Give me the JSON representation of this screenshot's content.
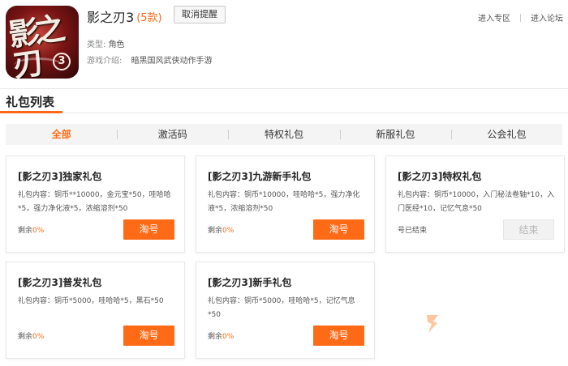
{
  "header": {
    "icon_text": "影之刃",
    "icon_number": "3",
    "title": "影之刃3",
    "count": "(5款)",
    "cancel_button": "取消提醒",
    "type_label": "类型:",
    "type_value": "角色",
    "intro_label": "游戏介绍:",
    "intro_value": "暗黑国风武侠动作手游",
    "links": [
      "进入专区",
      "进入论坛"
    ]
  },
  "section": {
    "title": "礼包列表"
  },
  "tabs": [
    {
      "label": "全部",
      "active": true
    },
    {
      "label": "激活码",
      "active": false
    },
    {
      "label": "特权礼包",
      "active": false
    },
    {
      "label": "新服礼包",
      "active": false
    },
    {
      "label": "公会礼包",
      "active": false
    }
  ],
  "cards": [
    {
      "title": "[影之刃3]独家礼包",
      "content": "礼包内容：铜币**10000，金元宝*50，哇哈哈*5，强力净化液*5，浓缩溶剂*50",
      "remain_label": "剩余",
      "remain_pct": "0%",
      "button": "淘号",
      "status": ""
    },
    {
      "title": "[影之刃3]九游新手礼包",
      "content": "礼包内容：铜币*10000，哇哈哈*5，强力净化液*5，浓缩溶剂*50",
      "remain_label": "剩余",
      "remain_pct": "0%",
      "button": "淘号",
      "status": ""
    },
    {
      "title": "[影之刃3]特权礼包",
      "content": "礼包内容：铜币*10000，入门秘法卷轴*10，入门医经*10，记忆气息*50",
      "remain_label": "",
      "remain_pct": "",
      "button": "结束",
      "status": "号已结束"
    },
    {
      "title": "[影之刃3]普发礼包",
      "content": "礼包内容：铜币*5000，哇哈哈*5，黑石*50",
      "remain_label": "剩余",
      "remain_pct": "0%",
      "button": "淘号",
      "status": ""
    },
    {
      "title": "[影之刃3]新手礼包",
      "content": "礼包内容：铜币*5000，哇哈哈*5，记忆气息*50",
      "remain_label": "剩余",
      "remain_pct": "0%",
      "button": "淘号",
      "status": ""
    }
  ],
  "colors": {
    "accent": "#ff6a16",
    "tab_bg": "#f4f4f4",
    "disabled_bg": "#f2f2f2"
  }
}
